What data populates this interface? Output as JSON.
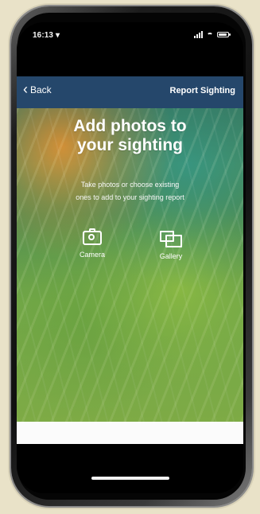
{
  "status_bar": {
    "time": "16:13 ▾"
  },
  "nav_bar": {
    "back_label": "Back",
    "title": "Report Sighting"
  },
  "hero": {
    "headline": "Add photos to\nyour sighting",
    "description": "Take photos or choose existing\nones to add to your sighting report"
  },
  "actions": {
    "camera_label": "Camera",
    "gallery_label": "Gallery"
  },
  "icons": {
    "back": "chevron-left-icon",
    "camera": "camera-icon",
    "gallery": "gallery-icon",
    "signal": "signal-icon",
    "wifi": "wifi-icon",
    "battery": "battery-icon"
  },
  "colors": {
    "nav_bar": "#2A517A",
    "page_background": "#E9E2C8",
    "text_primary": "#FFFFFF",
    "hero_green": "#78AF4B",
    "hero_orange": "#F09531"
  }
}
